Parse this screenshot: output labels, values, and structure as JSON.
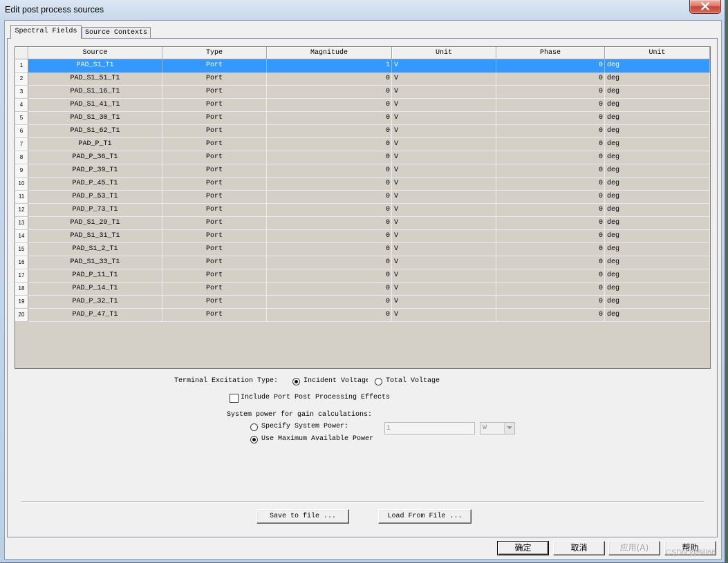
{
  "window": {
    "title": "Edit post process sources"
  },
  "tabs": {
    "spectral_fields": {
      "label": "Spectral Fields",
      "active": true
    },
    "source_contexts": {
      "label": "Source Contexts",
      "active": false
    }
  },
  "table": {
    "columns": {
      "source": "Source",
      "type": "Type",
      "magnitude": "Magnitude",
      "mag_unit": "Unit",
      "phase": "Phase",
      "phase_unit": "Unit"
    },
    "rows": [
      {
        "index": "1",
        "source": "PAD_S1_T1",
        "type": "Port",
        "magnitude": "1",
        "mag_unit": "V",
        "phase": "0",
        "phase_unit": "deg",
        "selected": true
      },
      {
        "index": "2",
        "source": "PAD_S1_51_T1",
        "type": "Port",
        "magnitude": "0",
        "mag_unit": "V",
        "phase": "0",
        "phase_unit": "deg"
      },
      {
        "index": "3",
        "source": "PAD_S1_16_T1",
        "type": "Port",
        "magnitude": "0",
        "mag_unit": "V",
        "phase": "0",
        "phase_unit": "deg"
      },
      {
        "index": "4",
        "source": "PAD_S1_41_T1",
        "type": "Port",
        "magnitude": "0",
        "mag_unit": "V",
        "phase": "0",
        "phase_unit": "deg"
      },
      {
        "index": "5",
        "source": "PAD_S1_30_T1",
        "type": "Port",
        "magnitude": "0",
        "mag_unit": "V",
        "phase": "0",
        "phase_unit": "deg"
      },
      {
        "index": "6",
        "source": "PAD_S1_62_T1",
        "type": "Port",
        "magnitude": "0",
        "mag_unit": "V",
        "phase": "0",
        "phase_unit": "deg"
      },
      {
        "index": "7",
        "source": "PAD_P_T1",
        "type": "Port",
        "magnitude": "0",
        "mag_unit": "V",
        "phase": "0",
        "phase_unit": "deg"
      },
      {
        "index": "8",
        "source": "PAD_P_36_T1",
        "type": "Port",
        "magnitude": "0",
        "mag_unit": "V",
        "phase": "0",
        "phase_unit": "deg"
      },
      {
        "index": "9",
        "source": "PAD_P_39_T1",
        "type": "Port",
        "magnitude": "0",
        "mag_unit": "V",
        "phase": "0",
        "phase_unit": "deg"
      },
      {
        "index": "10",
        "source": "PAD_P_45_T1",
        "type": "Port",
        "magnitude": "0",
        "mag_unit": "V",
        "phase": "0",
        "phase_unit": "deg"
      },
      {
        "index": "11",
        "source": "PAD_P_53_T1",
        "type": "Port",
        "magnitude": "0",
        "mag_unit": "V",
        "phase": "0",
        "phase_unit": "deg"
      },
      {
        "index": "12",
        "source": "PAD_P_73_T1",
        "type": "Port",
        "magnitude": "0",
        "mag_unit": "V",
        "phase": "0",
        "phase_unit": "deg"
      },
      {
        "index": "13",
        "source": "PAD_S1_29_T1",
        "type": "Port",
        "magnitude": "0",
        "mag_unit": "V",
        "phase": "0",
        "phase_unit": "deg"
      },
      {
        "index": "14",
        "source": "PAD_S1_31_T1",
        "type": "Port",
        "magnitude": "0",
        "mag_unit": "V",
        "phase": "0",
        "phase_unit": "deg"
      },
      {
        "index": "15",
        "source": "PAD_S1_2_T1",
        "type": "Port",
        "magnitude": "0",
        "mag_unit": "V",
        "phase": "0",
        "phase_unit": "deg"
      },
      {
        "index": "16",
        "source": "PAD_S1_33_T1",
        "type": "Port",
        "magnitude": "0",
        "mag_unit": "V",
        "phase": "0",
        "phase_unit": "deg"
      },
      {
        "index": "17",
        "source": "PAD_P_11_T1",
        "type": "Port",
        "magnitude": "0",
        "mag_unit": "V",
        "phase": "0",
        "phase_unit": "deg"
      },
      {
        "index": "18",
        "source": "PAD_P_14_T1",
        "type": "Port",
        "magnitude": "0",
        "mag_unit": "V",
        "phase": "0",
        "phase_unit": "deg"
      },
      {
        "index": "19",
        "source": "PAD_P_32_T1",
        "type": "Port",
        "magnitude": "0",
        "mag_unit": "V",
        "phase": "0",
        "phase_unit": "deg"
      },
      {
        "index": "20",
        "source": "PAD_P_47_T1",
        "type": "Port",
        "magnitude": "0",
        "mag_unit": "V",
        "phase": "0",
        "phase_unit": "deg"
      }
    ]
  },
  "excitation": {
    "label": "Terminal Excitation Type:",
    "incident": {
      "label": "Incident Voltage",
      "checked": true
    },
    "total": {
      "label": "Total Voltage",
      "checked": false
    }
  },
  "include_effects": {
    "label": "Include Port Post Processing Effects",
    "checked": false
  },
  "system_power": {
    "label": "System power for gain calculations:",
    "specify": {
      "label": "Specify System Power:",
      "checked": false
    },
    "power_value": {
      "value": "1",
      "enabled": false
    },
    "power_unit": {
      "value": "W",
      "enabled": false
    },
    "use_max": {
      "label": "Use Maximum Available Power",
      "checked": true
    }
  },
  "file_buttons": {
    "save": "Save to file ...",
    "load": "Load From File ..."
  },
  "dialog_buttons": {
    "ok": {
      "label": "确定"
    },
    "cancel": {
      "label": "取消"
    },
    "apply": {
      "label": "应用(A)",
      "enabled": false
    },
    "help": {
      "label": "帮助"
    }
  },
  "watermark": "CSDN @Bill66",
  "icons": {
    "close": "close-icon",
    "dropdown": "chevron-down-icon"
  },
  "colors": {
    "selection": "#3399ff",
    "grid_cell": "#d4d0c8",
    "close_button": "#c7443a",
    "dialog_bg": "#f0f0f0"
  }
}
